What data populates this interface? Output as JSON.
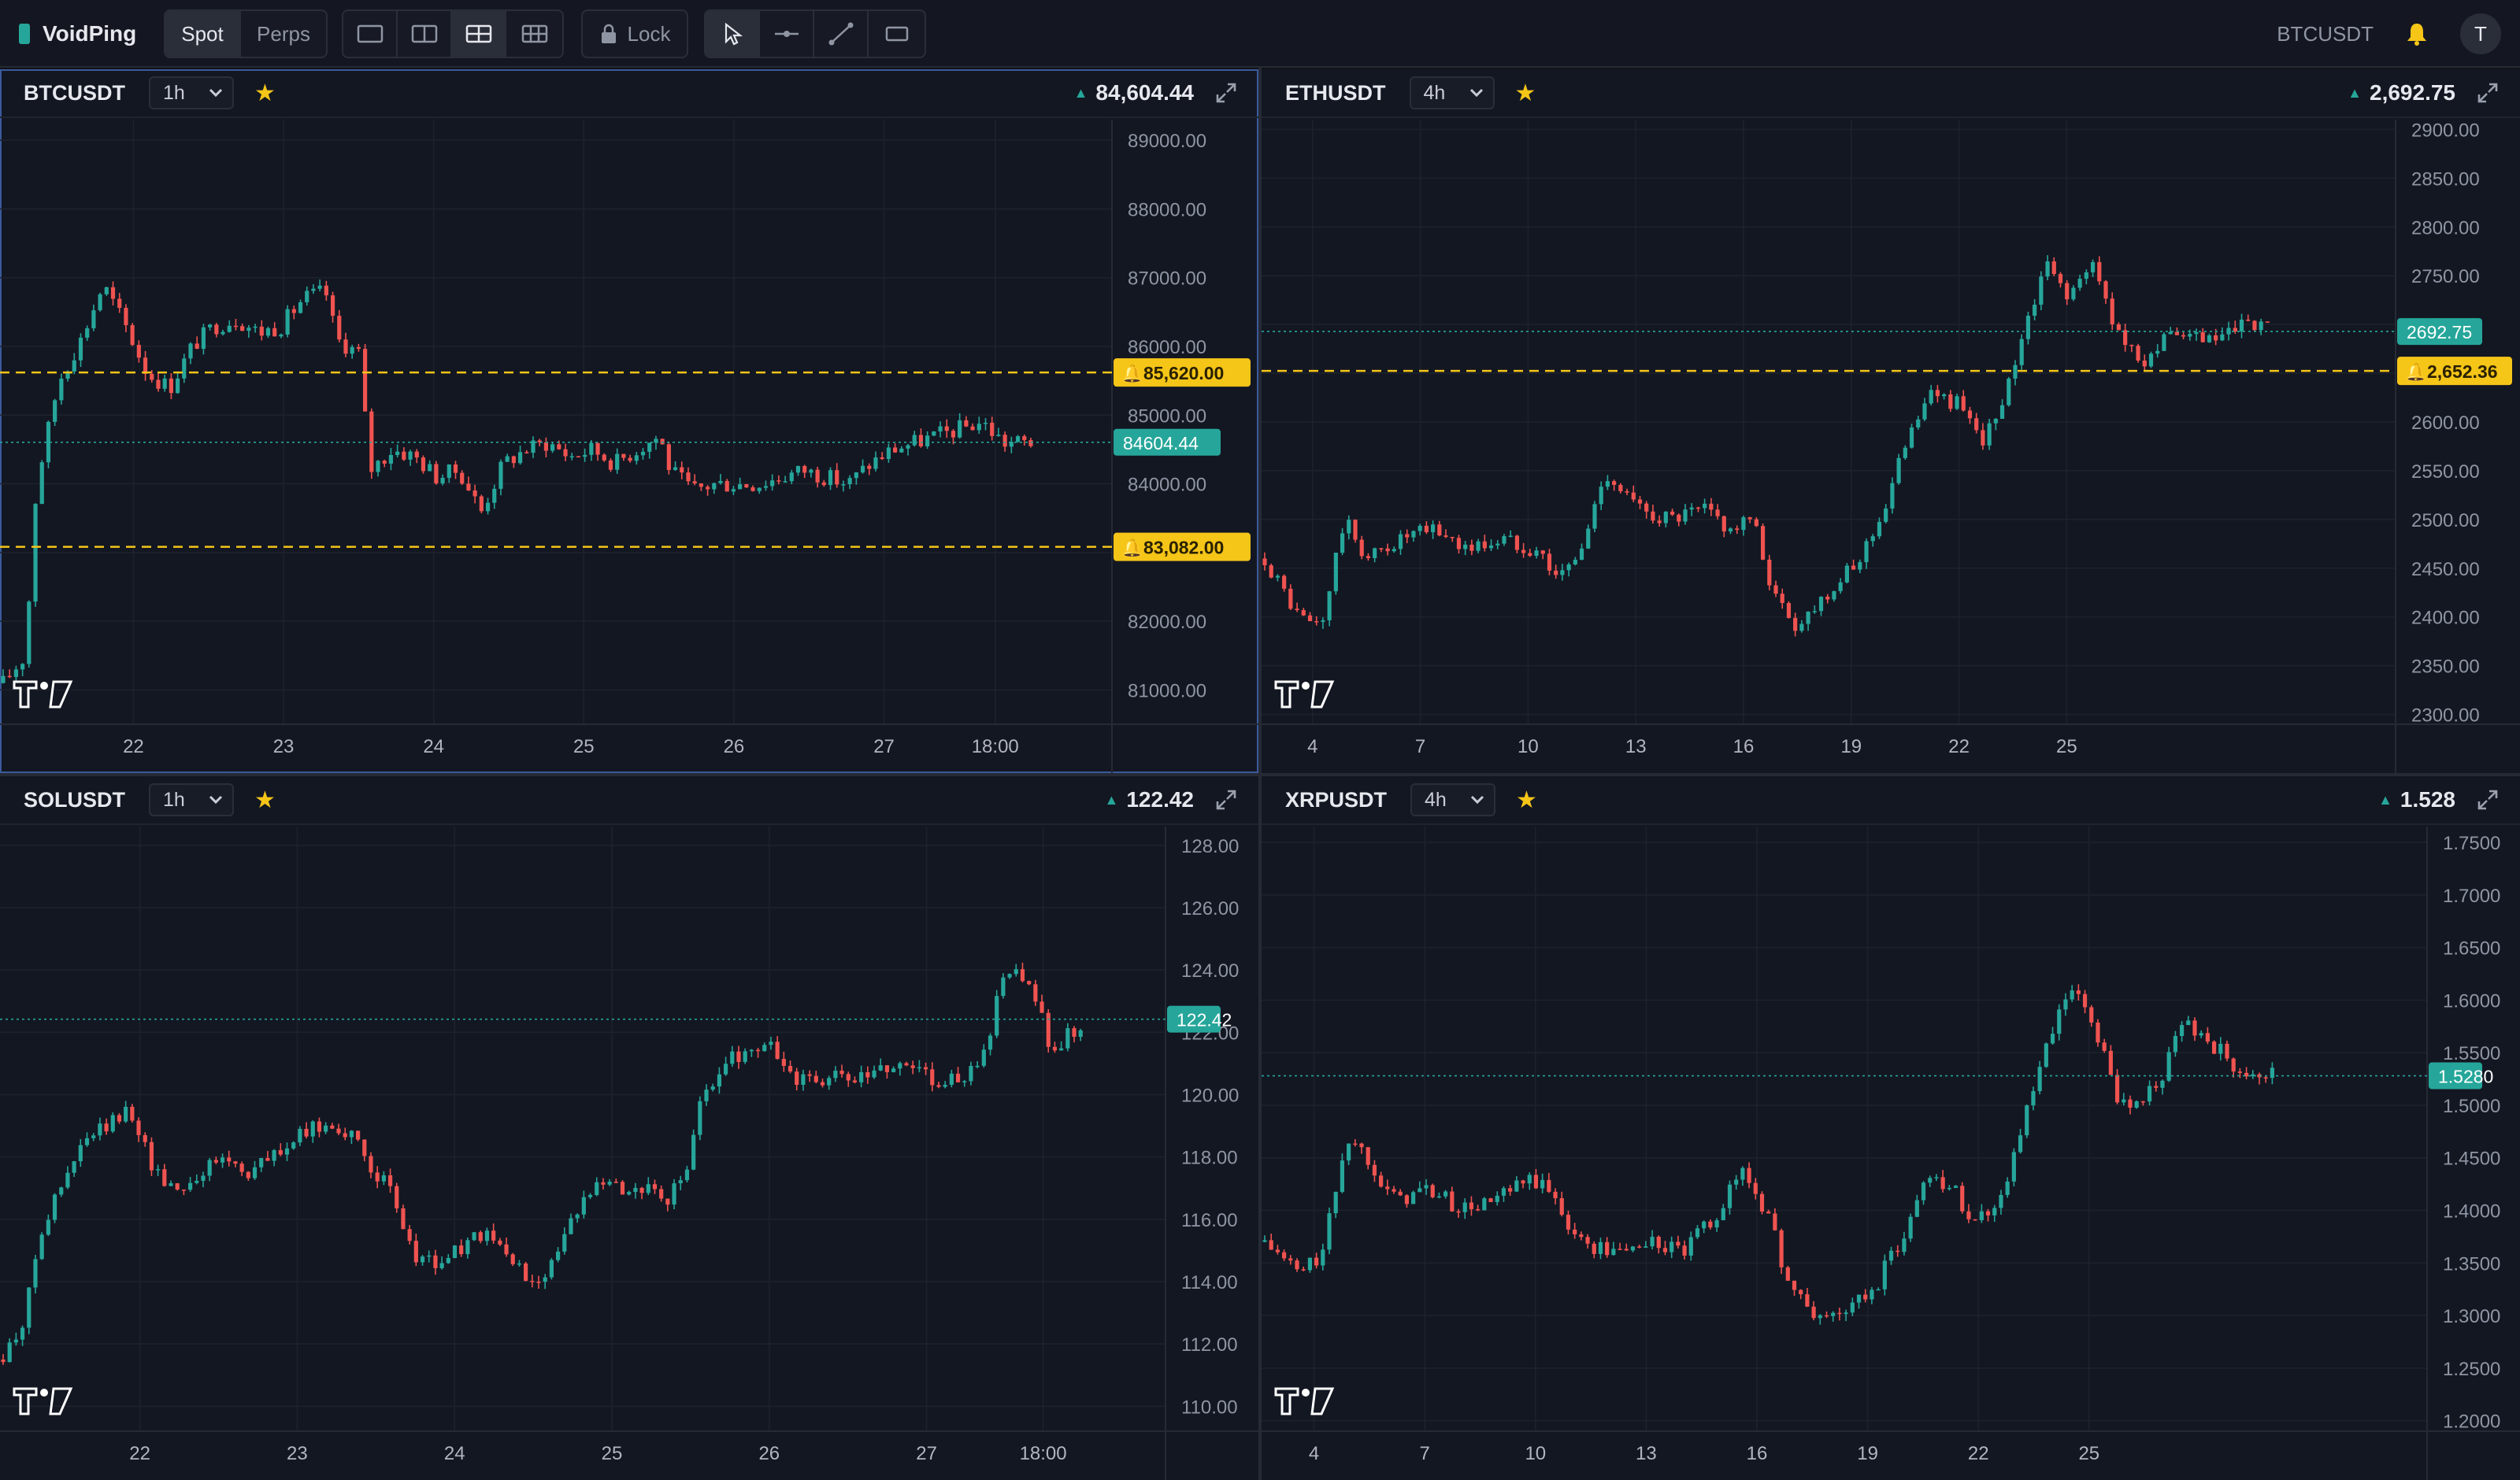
{
  "app": {
    "name": "VoidPing"
  },
  "toolbar": {
    "market_tabs": [
      {
        "label": "Spot",
        "active": true
      },
      {
        "label": "Perps",
        "active": false
      }
    ],
    "layouts": [
      {
        "icon": "layout-single-icon"
      },
      {
        "icon": "layout-two-icon"
      },
      {
        "icon": "layout-four-icon",
        "active": true
      },
      {
        "icon": "layout-six-icon"
      }
    ],
    "lock_label": "Lock",
    "tools": [
      {
        "icon": "cursor-icon",
        "active": true
      },
      {
        "icon": "horizontal-line-icon"
      },
      {
        "icon": "trend-line-icon"
      },
      {
        "icon": "rectangle-icon"
      }
    ],
    "active_symbol": "BTCUSDT",
    "avatar_initial": "T"
  },
  "colors": {
    "up": "#26a69a",
    "down": "#ef5350",
    "alert": "#f5c518",
    "bg": "#131722",
    "grid": "#1e222d"
  },
  "panels": [
    {
      "symbol": "BTCUSDT",
      "timeframe": "1h",
      "price": "84,604.44",
      "price_label": "84604.44",
      "last": 84604.44,
      "yticks": [
        "89000.00",
        "88000.00",
        "87000.00",
        "86000.00",
        "85000.00",
        "84000.00",
        "83000.00",
        "82000.00",
        "81000.00"
      ],
      "ymin": 80500,
      "ymax": 89300,
      "xticks": [
        "22",
        "23",
        "24",
        "25",
        "26",
        "27",
        "18:00"
      ],
      "alerts": [
        {
          "label": "85,620.00",
          "value": 85620
        },
        {
          "label": "83,082.00",
          "value": 83082
        }
      ],
      "chart_data": {
        "type": "candlestick",
        "x_range": [
          "21",
          "27 18:00"
        ],
        "path": [
          [
            0,
            81100
          ],
          [
            0.02,
            81500
          ],
          [
            0.03,
            84000
          ],
          [
            0.05,
            85500
          ],
          [
            0.07,
            86100
          ],
          [
            0.09,
            86900
          ],
          [
            0.11,
            86300
          ],
          [
            0.13,
            85600
          ],
          [
            0.15,
            85400
          ],
          [
            0.17,
            86000
          ],
          [
            0.19,
            86300
          ],
          [
            0.21,
            86400
          ],
          [
            0.23,
            86200
          ],
          [
            0.25,
            86300
          ],
          [
            0.27,
            86700
          ],
          [
            0.29,
            86800
          ],
          [
            0.3,
            86100
          ],
          [
            0.32,
            85900
          ],
          [
            0.33,
            84200
          ],
          [
            0.35,
            84500
          ],
          [
            0.37,
            84400
          ],
          [
            0.39,
            84100
          ],
          [
            0.41,
            84200
          ],
          [
            0.43,
            83600
          ],
          [
            0.45,
            84300
          ],
          [
            0.47,
            84500
          ],
          [
            0.49,
            84600
          ],
          [
            0.51,
            84400
          ],
          [
            0.53,
            84500
          ],
          [
            0.55,
            84300
          ],
          [
            0.57,
            84500
          ],
          [
            0.59,
            84700
          ],
          [
            0.6,
            84200
          ],
          [
            0.62,
            83900
          ],
          [
            0.64,
            84000
          ],
          [
            0.66,
            84000
          ],
          [
            0.68,
            84000
          ],
          [
            0.7,
            84100
          ],
          [
            0.72,
            84200
          ],
          [
            0.74,
            84100
          ],
          [
            0.76,
            84000
          ],
          [
            0.78,
            84300
          ],
          [
            0.8,
            84500
          ],
          [
            0.82,
            84600
          ],
          [
            0.84,
            84700
          ],
          [
            0.86,
            84800
          ],
          [
            0.88,
            84900
          ],
          [
            0.9,
            84600
          ],
          [
            0.93,
            84604
          ]
        ]
      }
    },
    {
      "symbol": "ETHUSDT",
      "timeframe": "4h",
      "price": "2,692.75",
      "price_label": "2692.75",
      "last": 2692.75,
      "yticks": [
        "2900.00",
        "2850.00",
        "2800.00",
        "2750.00",
        "2700.00",
        "2650.00",
        "2600.00",
        "2550.00",
        "2500.00",
        "2450.00",
        "2400.00",
        "2350.00",
        "2300.00"
      ],
      "ymin": 2290,
      "ymax": 2910,
      "xticks": [
        "4",
        "7",
        "10",
        "13",
        "16",
        "19",
        "22",
        "25"
      ],
      "alerts": [
        {
          "label": "2,652.36",
          "value": 2652.36
        }
      ],
      "chart_data": {
        "type": "candlestick",
        "x_range": [
          "1",
          "28"
        ],
        "path": [
          [
            0,
            2460
          ],
          [
            0.03,
            2400
          ],
          [
            0.05,
            2390
          ],
          [
            0.07,
            2500
          ],
          [
            0.09,
            2460
          ],
          [
            0.12,
            2480
          ],
          [
            0.15,
            2490
          ],
          [
            0.18,
            2470
          ],
          [
            0.21,
            2480
          ],
          [
            0.24,
            2470
          ],
          [
            0.26,
            2440
          ],
          [
            0.28,
            2470
          ],
          [
            0.3,
            2550
          ],
          [
            0.33,
            2510
          ],
          [
            0.36,
            2500
          ],
          [
            0.39,
            2510
          ],
          [
            0.41,
            2490
          ],
          [
            0.43,
            2500
          ],
          [
            0.45,
            2420
          ],
          [
            0.47,
            2390
          ],
          [
            0.49,
            2420
          ],
          [
            0.52,
            2450
          ],
          [
            0.55,
            2520
          ],
          [
            0.57,
            2600
          ],
          [
            0.59,
            2630
          ],
          [
            0.61,
            2620
          ],
          [
            0.63,
            2580
          ],
          [
            0.65,
            2610
          ],
          [
            0.67,
            2700
          ],
          [
            0.69,
            2760
          ],
          [
            0.71,
            2730
          ],
          [
            0.73,
            2760
          ],
          [
            0.75,
            2700
          ],
          [
            0.77,
            2660
          ],
          [
            0.79,
            2680
          ],
          [
            0.81,
            2690
          ],
          [
            0.83,
            2680
          ],
          [
            0.85,
            2690
          ],
          [
            0.87,
            2700
          ],
          [
            0.89,
            2692.75
          ]
        ]
      }
    },
    {
      "symbol": "SOLUSDT",
      "timeframe": "1h",
      "price": "122.42",
      "price_label": "122.42",
      "last": 122.42,
      "yticks": [
        "128.00",
        "126.00",
        "124.00",
        "122.00",
        "120.00",
        "118.00",
        "116.00",
        "114.00",
        "112.00",
        "110.00"
      ],
      "ymin": 109.2,
      "ymax": 128.6,
      "xticks": [
        "22",
        "23",
        "24",
        "25",
        "26",
        "27",
        "18:00"
      ],
      "alerts": [],
      "chart_data": {
        "type": "candlestick",
        "x_range": [
          "21",
          "27 18:00"
        ],
        "path": [
          [
            0,
            111.5
          ],
          [
            0.02,
            113
          ],
          [
            0.03,
            115.5
          ],
          [
            0.05,
            117
          ],
          [
            0.07,
            118.5
          ],
          [
            0.09,
            119
          ],
          [
            0.11,
            119.5
          ],
          [
            0.13,
            117.5
          ],
          [
            0.15,
            117
          ],
          [
            0.17,
            117.5
          ],
          [
            0.19,
            118
          ],
          [
            0.21,
            117.5
          ],
          [
            0.23,
            118
          ],
          [
            0.25,
            118.5
          ],
          [
            0.27,
            119
          ],
          [
            0.29,
            119
          ],
          [
            0.31,
            118
          ],
          [
            0.33,
            117
          ],
          [
            0.35,
            115
          ],
          [
            0.37,
            114.5
          ],
          [
            0.39,
            115
          ],
          [
            0.41,
            115.5
          ],
          [
            0.43,
            115
          ],
          [
            0.45,
            114
          ],
          [
            0.47,
            114.5
          ],
          [
            0.49,
            116
          ],
          [
            0.51,
            117.5
          ],
          [
            0.53,
            117
          ],
          [
            0.55,
            117
          ],
          [
            0.57,
            116.5
          ],
          [
            0.59,
            118
          ],
          [
            0.6,
            120
          ],
          [
            0.62,
            121
          ],
          [
            0.64,
            121.5
          ],
          [
            0.66,
            121.5
          ],
          [
            0.68,
            120.5
          ],
          [
            0.7,
            120.5
          ],
          [
            0.72,
            120.5
          ],
          [
            0.74,
            120.5
          ],
          [
            0.76,
            121
          ],
          [
            0.78,
            121
          ],
          [
            0.8,
            120.5
          ],
          [
            0.82,
            120.5
          ],
          [
            0.84,
            121
          ],
          [
            0.86,
            124
          ],
          [
            0.88,
            123.5
          ],
          [
            0.9,
            121.5
          ],
          [
            0.93,
            122.42
          ]
        ]
      }
    },
    {
      "symbol": "XRPUSDT",
      "timeframe": "4h",
      "price": "1.528",
      "price_label": "1.5280",
      "last": 1.528,
      "yticks": [
        "1.7500",
        "1.7000",
        "1.6500",
        "1.6000",
        "1.5500",
        "1.5000",
        "1.4500",
        "1.4000",
        "1.3500",
        "1.3000",
        "1.2500",
        "1.2000"
      ],
      "ymin": 1.19,
      "ymax": 1.765,
      "xticks": [
        "4",
        "7",
        "10",
        "13",
        "16",
        "19",
        "22",
        "25"
      ],
      "alerts": [],
      "chart_data": {
        "type": "candlestick",
        "x_range": [
          "1",
          "28"
        ],
        "path": [
          [
            0,
            1.37
          ],
          [
            0.03,
            1.34
          ],
          [
            0.05,
            1.36
          ],
          [
            0.07,
            1.47
          ],
          [
            0.09,
            1.45
          ],
          [
            0.11,
            1.41
          ],
          [
            0.14,
            1.42
          ],
          [
            0.17,
            1.4
          ],
          [
            0.2,
            1.41
          ],
          [
            0.23,
            1.43
          ],
          [
            0.25,
            1.41
          ],
          [
            0.27,
            1.37
          ],
          [
            0.3,
            1.36
          ],
          [
            0.33,
            1.37
          ],
          [
            0.36,
            1.36
          ],
          [
            0.39,
            1.4
          ],
          [
            0.41,
            1.44
          ],
          [
            0.43,
            1.4
          ],
          [
            0.45,
            1.33
          ],
          [
            0.47,
            1.3
          ],
          [
            0.49,
            1.3
          ],
          [
            0.52,
            1.32
          ],
          [
            0.55,
            1.38
          ],
          [
            0.57,
            1.44
          ],
          [
            0.59,
            1.42
          ],
          [
            0.61,
            1.39
          ],
          [
            0.63,
            1.41
          ],
          [
            0.65,
            1.48
          ],
          [
            0.67,
            1.55
          ],
          [
            0.69,
            1.61
          ],
          [
            0.71,
            1.58
          ],
          [
            0.73,
            1.51
          ],
          [
            0.75,
            1.5
          ],
          [
            0.77,
            1.53
          ],
          [
            0.79,
            1.58
          ],
          [
            0.81,
            1.56
          ],
          [
            0.83,
            1.54
          ],
          [
            0.86,
            1.53
          ],
          [
            0.87,
            1.528
          ]
        ]
      }
    }
  ]
}
